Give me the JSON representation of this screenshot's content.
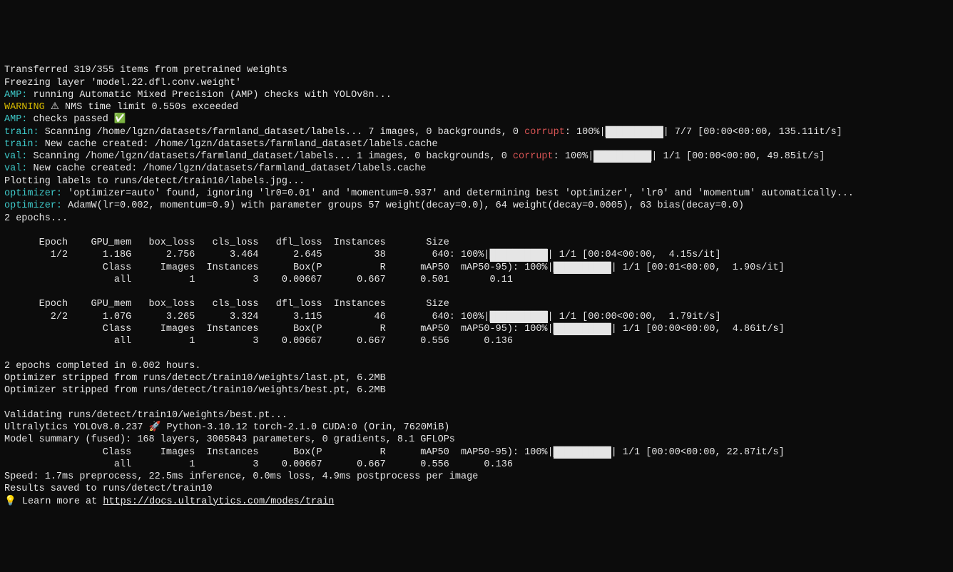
{
  "l0": "Transferred 319/355 items from pretrained weights",
  "l1": "Freezing layer 'model.22.dfl.conv.weight'",
  "amp1_tag": "AMP:",
  "amp1_txt": " running Automatic Mixed Precision (AMP) checks with YOLOv8n...",
  "warn_tag": "WARNING",
  "warn_txt": " ⚠ NMS time limit 0.550s exceeded",
  "amp2_tag": "AMP:",
  "amp2_txt": " checks passed ✅",
  "train_tag": "train:",
  "train1_a": " Scanning /home/lgzn/datasets/farmland_dataset/labels... 7 images, 0 backgrounds, 0 ",
  "corrupt": "corrupt",
  "train1_b": ": 100%|",
  "bar10": "██████████",
  "train1_c": "| 7/7 [00:00<00:00, 135.11it/s]",
  "train2": " New cache created: /home/lgzn/datasets/farmland_dataset/labels.cache",
  "val_tag": "val:",
  "val1_a": " Scanning /home/lgzn/datasets/farmland_dataset/labels... 1 images, 0 backgrounds, 0 ",
  "val1_b": ": 100%|",
  "val1_c": "| 1/1 [00:00<00:00, 49.85it/s]",
  "val2": " New cache created: /home/lgzn/datasets/farmland_dataset/labels.cache",
  "plotting": "Plotting labels to runs/detect/train10/labels.jpg... ",
  "opt_tag": "optimizer:",
  "opt1": " 'optimizer=auto' found, ignoring 'lr0=0.01' and 'momentum=0.937' and determining best 'optimizer', 'lr0' and 'momentum' automatically... ",
  "opt2": " AdamW(lr=0.002, momentum=0.9) with parameter groups 57 weight(decay=0.0), 64 weight(decay=0.0005), 63 bias(decay=0.0)",
  "epochs_start": "2 epochs...",
  "hdr1": "      Epoch    GPU_mem   box_loss   cls_loss   dfl_loss  Instances       Size",
  "e1r1a": "        1/2      1.18G      2.756      3.464      2.645         38        640: 100%|",
  "e1r1b": "| 1/1 [00:04<00:00,  4.15s/it]",
  "e1_clshdr_a": "                 Class     Images  Instances      Box(P          R      mAP50  mAP50-95): 100%|",
  "e1_clshdr_b": "| 1/1 [00:01<00:00,  1.90s/it]",
  "e1_all": "                   all          1          3    0.00667      0.667      0.501       0.11",
  "hdr2": "      Epoch    GPU_mem   box_loss   cls_loss   dfl_loss  Instances       Size",
  "e2r1a": "        2/2      1.07G      3.265      3.324      3.115         46        640: 100%|",
  "e2r1b": "| 1/1 [00:00<00:00,  1.79it/s]",
  "e2_clshdr_a": "                 Class     Images  Instances      Box(P          R      mAP50  mAP50-95): 100%|",
  "e2_clshdr_b": "| 1/1 [00:00<00:00,  4.86it/s]",
  "e2_all": "                   all          1          3    0.00667      0.667      0.556      0.136",
  "done1": "2 epochs completed in 0.002 hours.",
  "done2": "Optimizer stripped from runs/detect/train10/weights/last.pt, 6.2MB",
  "done3": "Optimizer stripped from runs/detect/train10/weights/best.pt, 6.2MB",
  "valid": "Validating runs/detect/train10/weights/best.pt...",
  "ultra": "Ultralytics YOLOv8.0.237 🚀 Python-3.10.12 torch-2.1.0 CUDA:0 (Orin, 7620MiB)",
  "summary": "Model summary (fused): 168 layers, 3005843 parameters, 0 gradients, 8.1 GFLOPs",
  "final_hdr_a": "                 Class     Images  Instances      Box(P          R      mAP50  mAP50-95): 100%|",
  "final_hdr_b": "| 1/1 [00:00<00:00, 22.87it/s]",
  "final_all": "                   all          1          3    0.00667      0.667      0.556      0.136",
  "speed": "Speed: 1.7ms preprocess, 22.5ms inference, 0.0ms loss, 4.9ms postprocess per image",
  "saved_a": "Results saved to ",
  "saved_b": "runs/detect/train10",
  "learn_a": "💡 Learn more at ",
  "learn_b": "https://docs.ultralytics.com/modes/train"
}
